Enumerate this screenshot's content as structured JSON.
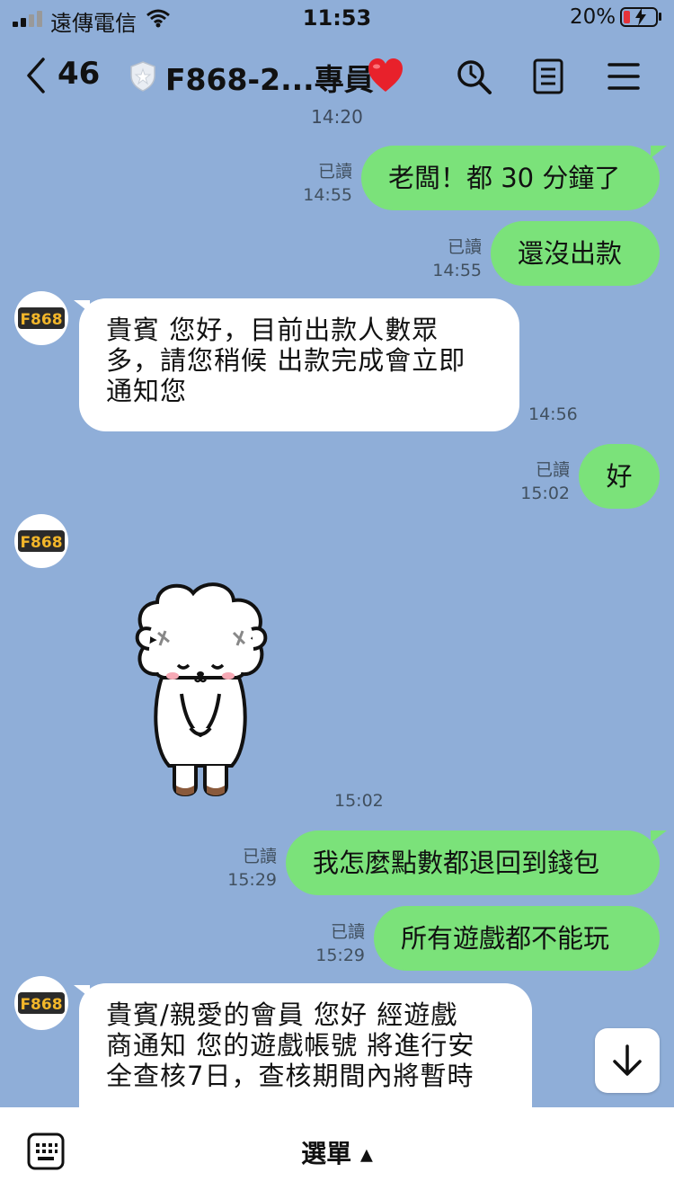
{
  "status_bar": {
    "carrier": "遠傳電信",
    "time": "11:53",
    "battery_pct": "20%",
    "battery_level": 0.2,
    "icons": [
      "signal-icon",
      "wifi-icon",
      "battery-charging-icon"
    ]
  },
  "header": {
    "back_count": "46",
    "title": "F868-2...專員",
    "icons": [
      "back-chevron-icon",
      "shield-badge-icon",
      "heart-icon",
      "search-icon",
      "notes-icon",
      "menu-icon"
    ]
  },
  "chat": {
    "partial_time_top": "14:20",
    "messages": [
      {
        "side": "mine",
        "text": "老闆！都 30 分鐘了",
        "read": "已讀",
        "time": "14:55"
      },
      {
        "side": "mine",
        "text": "還沒出款",
        "read": "已讀",
        "time": "14:55"
      },
      {
        "side": "theirs",
        "lines": [
          "貴賓 您好，目前出款人數眾",
          "多，請您稍候 出款完成會立即",
          "通知您"
        ],
        "time": "14:56"
      },
      {
        "side": "mine",
        "text": "好",
        "read": "已讀",
        "time": "15:02"
      },
      {
        "side": "theirs",
        "type": "sticker",
        "sticker": "bowing-sheep-sticker",
        "time": "15:02"
      },
      {
        "side": "mine",
        "text": "我怎麼點數都退回到錢包",
        "read": "已讀",
        "time": "15:29"
      },
      {
        "side": "mine",
        "text": "所有遊戲都不能玩",
        "read": "已讀",
        "time": "15:29"
      },
      {
        "side": "theirs",
        "lines": [
          "貴賓/親愛的會員 您好 經遊戲",
          "商通知 您的遊戲帳號 將進行安",
          "全查核7日，查核期間內將暫時"
        ]
      }
    ],
    "avatar_text": "F868"
  },
  "footer": {
    "menu_label": "選單 ▴",
    "icons": [
      "keyboard-icon",
      "scroll-down-icon"
    ]
  }
}
